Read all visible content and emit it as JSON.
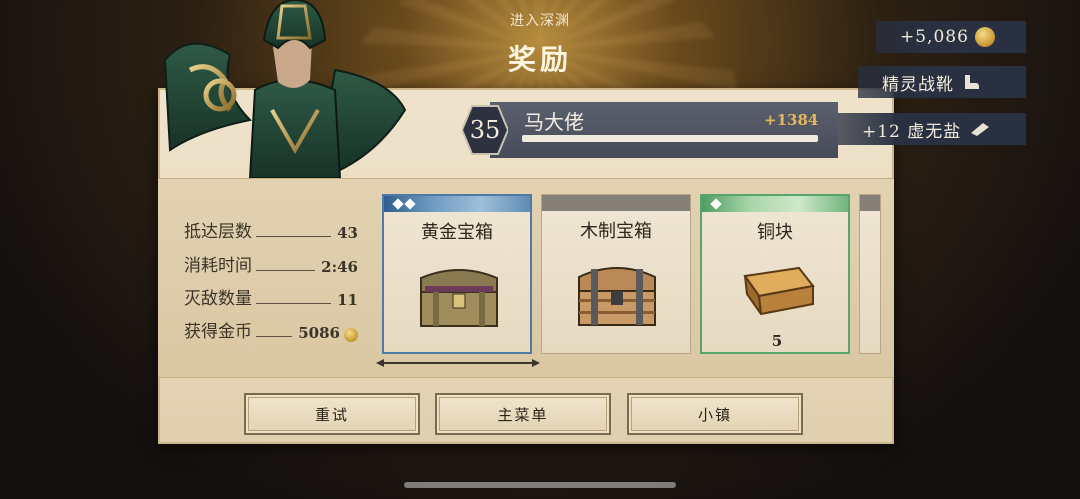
{
  "header": {
    "subtitle": "进入深渊",
    "title": "奖励"
  },
  "player": {
    "level": "35",
    "name": "马大佬",
    "xp_gain": "+1384",
    "xp_progress": 1.0
  },
  "rewards_strip": {
    "gold": "+5,086",
    "item": "精灵战靴",
    "resource": "+12 虚无盐"
  },
  "stats": [
    {
      "label": "抵达层数",
      "value": "43"
    },
    {
      "label": "消耗时间",
      "value": "2:46"
    },
    {
      "label": "灭敌数量",
      "value": "11"
    },
    {
      "label": "获得金币",
      "value": "5086"
    }
  ],
  "cards": [
    {
      "title": "黄金宝箱",
      "rarity_diamonds": 2,
      "quantity": "",
      "color": "#4e7aa4"
    },
    {
      "title": "木制宝箱",
      "rarity_diamonds": 0,
      "quantity": "",
      "color": "#858077"
    },
    {
      "title": "铜块",
      "rarity_diamonds": 1,
      "quantity": "5",
      "color": "#5aa56e"
    }
  ],
  "buttons": {
    "retry": "重试",
    "main_menu": "主菜单",
    "town": "小镇"
  },
  "icons": [
    "coin-icon",
    "boots-icon",
    "salt-icon",
    "level-badge-icon",
    "chest-icon",
    "copper-ingot-icon"
  ],
  "colors": {
    "accent_gold": "#e5b75a",
    "parchment": "#e8d9bd",
    "pill_bg": "#283042"
  }
}
